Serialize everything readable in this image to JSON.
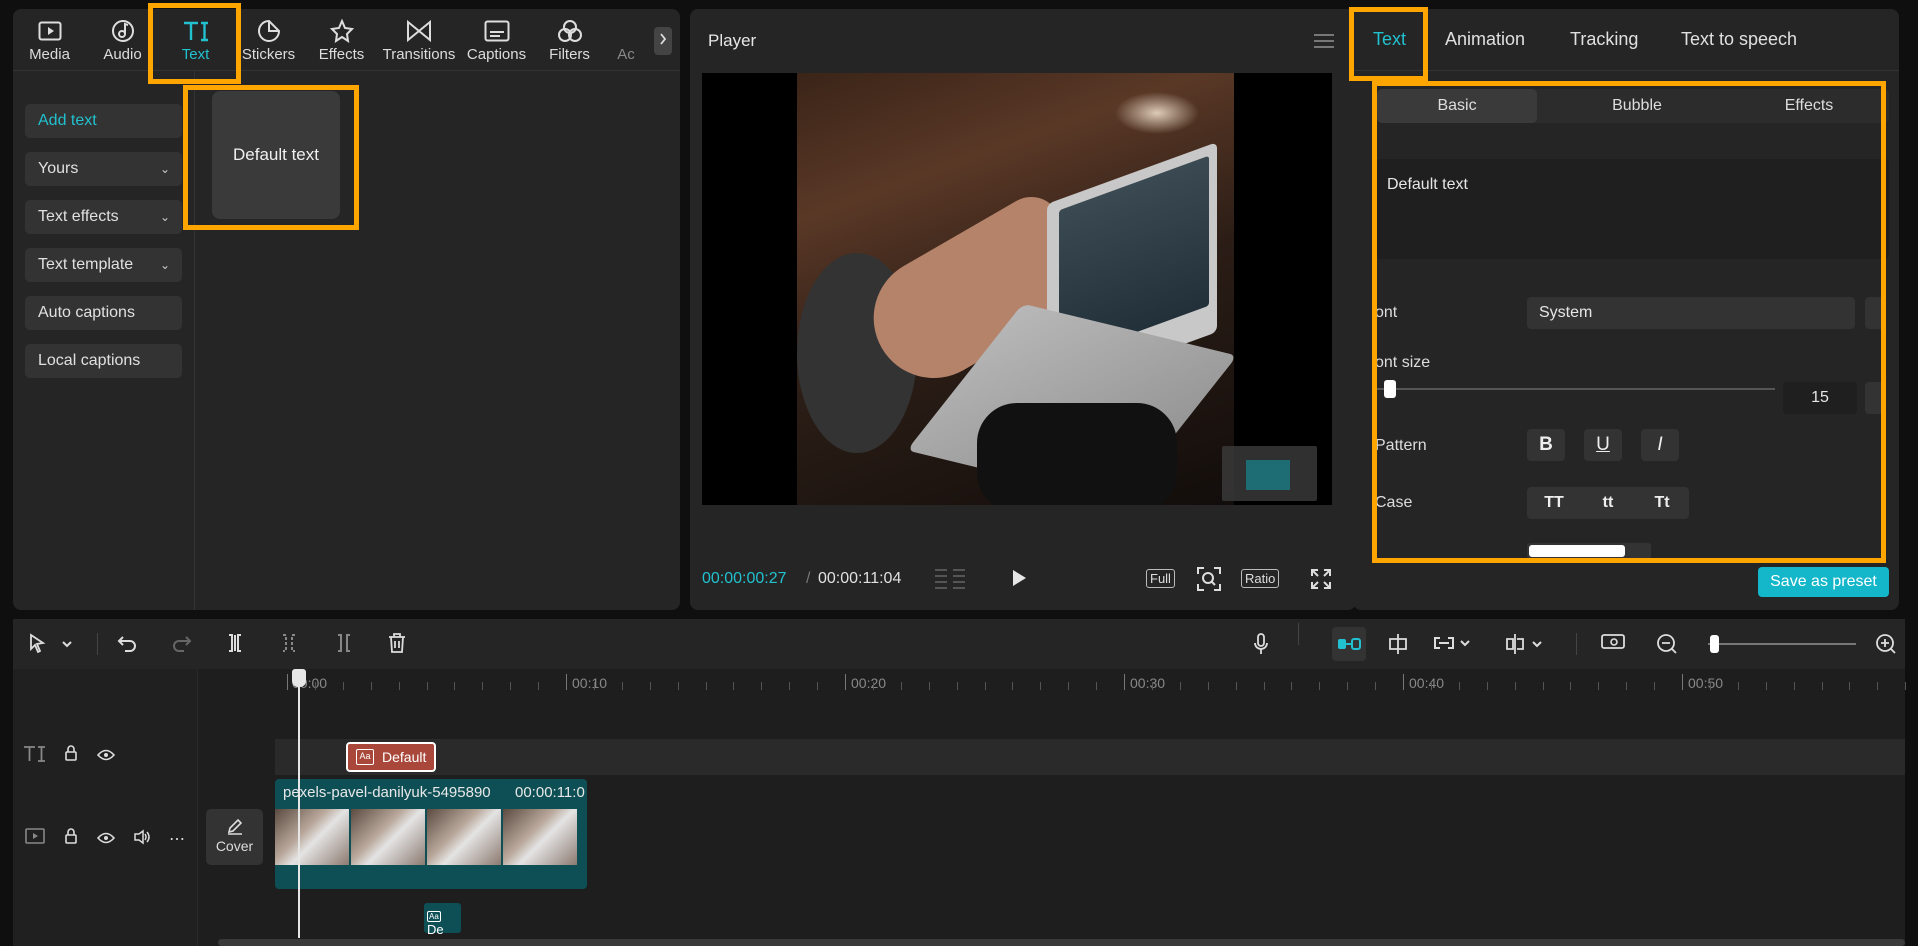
{
  "toolbar": {
    "tabs": [
      {
        "label": "Media",
        "icon": "media-icon"
      },
      {
        "label": "Audio",
        "icon": "audio-icon"
      },
      {
        "label": "Text",
        "icon": "text-icon"
      },
      {
        "label": "Stickers",
        "icon": "stickers-icon"
      },
      {
        "label": "Effects",
        "icon": "effects-icon"
      },
      {
        "label": "Transitions",
        "icon": "transitions-icon"
      },
      {
        "label": "Captions",
        "icon": "captions-icon"
      },
      {
        "label": "Filters",
        "icon": "filters-icon"
      },
      {
        "label": "Ac",
        "icon": "adjust-icon"
      }
    ],
    "active_tab": "Text"
  },
  "text_nav": {
    "add_text": "Add text",
    "yours": "Yours",
    "text_effects": "Text effects",
    "text_template": "Text template",
    "auto_captions": "Auto captions",
    "local_captions": "Local captions"
  },
  "text_library": {
    "default_card": "Default text"
  },
  "player": {
    "title": "Player",
    "current_time": "00:00:00:27",
    "separator": "/",
    "total_time": "00:00:11:04",
    "full_label": "Full",
    "ratio_label": "Ratio"
  },
  "inspector": {
    "tabs": [
      "Text",
      "Animation",
      "Tracking",
      "Text to speech"
    ],
    "active_tab": "Text",
    "sub_tabs": [
      "Basic",
      "Bubble",
      "Effects"
    ],
    "active_sub_tab": "Basic",
    "text_value": "Default text",
    "font_label": "ont",
    "font_value": "System",
    "font_size_label": "ont size",
    "font_size_value": "15",
    "font_size_fraction": 0.02,
    "pattern_label": "Pattern",
    "pattern_buttons": [
      "B",
      "U",
      "I"
    ],
    "case_label": "Case",
    "case_buttons": [
      "TT",
      "tt",
      "Tt"
    ],
    "save_preset": "Save as preset"
  },
  "timeline": {
    "ruler_labels": [
      "00:00",
      "00:10",
      "00:20",
      "00:30",
      "00:40",
      "00:50"
    ],
    "text_clip_label": "Default",
    "video_clip_name": "pexels-pavel-danilyuk-5495890",
    "video_clip_duration": "00:00:11:0",
    "cover_label": "Cover",
    "mini_clip_label": "De"
  },
  "colors": {
    "accent": "#21c1cf",
    "highlight": "#ffa500",
    "save_button": "#14b7c9",
    "text_clip": "#a9483a",
    "video_clip": "#0e4f55"
  }
}
